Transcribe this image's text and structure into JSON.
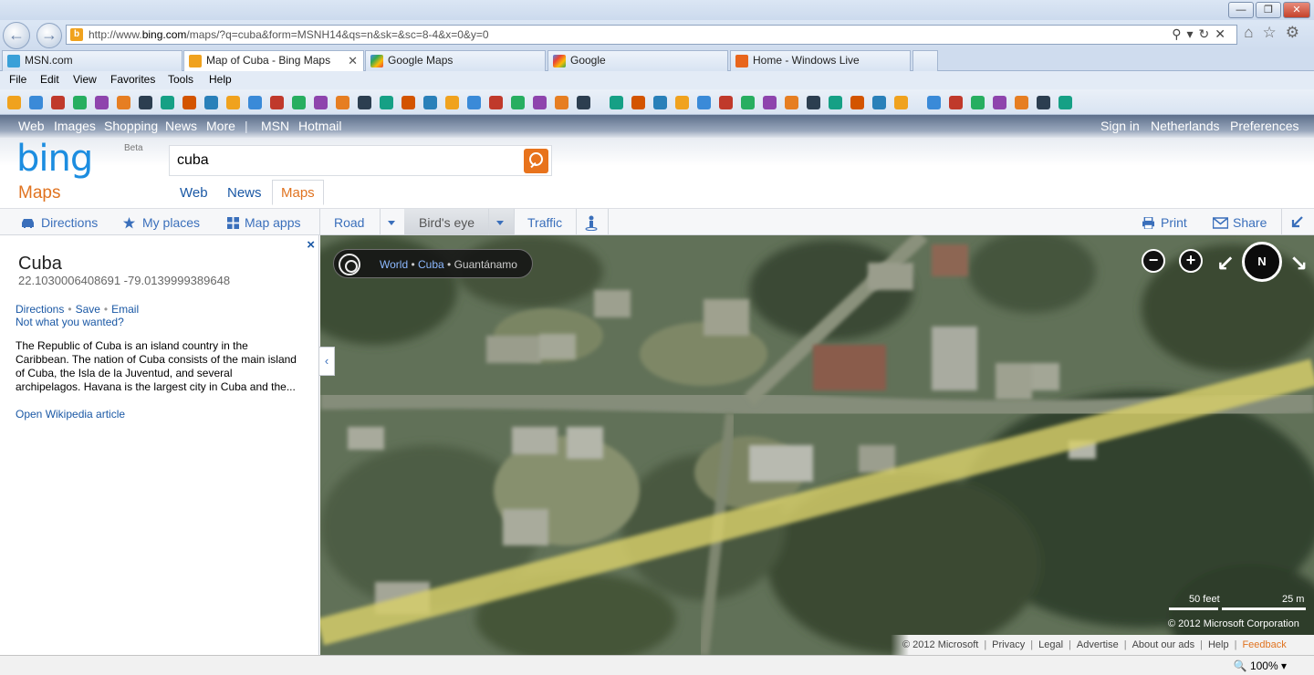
{
  "browser": {
    "url_prefix": "http://www.",
    "url_domain": "bing.com",
    "url_path": "/maps/?q=cuba&form=MSNH14&qs=n&sk=&sc=8-4&x=0&y=0",
    "tabs": [
      {
        "label": "MSN.com",
        "active": false
      },
      {
        "label": "Map of Cuba - Bing Maps",
        "active": true
      },
      {
        "label": "Google Maps",
        "active": false
      },
      {
        "label": "Google",
        "active": false
      },
      {
        "label": "Home - Windows Live",
        "active": false
      }
    ],
    "menu": [
      "File",
      "Edit",
      "View",
      "Favorites",
      "Tools",
      "Help"
    ],
    "zoom_level": "100%",
    "win_buttons": {
      "minimize": "—",
      "restore": "❐",
      "close": "✕"
    }
  },
  "bing": {
    "nav_left": [
      "Web",
      "Images",
      "Shopping",
      "News",
      "More",
      "|",
      "MSN",
      "Hotmail"
    ],
    "nav_right": [
      "Sign in",
      "Netherlands",
      "Preferences"
    ],
    "logo": "bing",
    "beta": "Beta",
    "section": "Maps",
    "search_value": "cuba",
    "vertical_tabs": [
      "Web",
      "News",
      "Maps"
    ]
  },
  "toolbar": {
    "directions": "Directions",
    "my_places": "My places",
    "map_apps": "Map apps",
    "road": "Road",
    "birds_eye": "Bird's eye",
    "traffic": "Traffic",
    "print": "Print",
    "share": "Share"
  },
  "result": {
    "title": "Cuba",
    "coords": "22.1030006408691 -79.0139999389648",
    "link_directions": "Directions",
    "link_save": "Save",
    "link_email": "Email",
    "not_what": "Not what you wanted?",
    "description": "The Republic of Cuba is an island country in the Caribbean. The nation of Cuba consists of the main island of Cuba, the Isla de la Juventud, and several archipelagos. Havana is the largest city in Cuba and the...",
    "wiki_link": "Open Wikipedia article",
    "close": "×"
  },
  "map": {
    "breadcrumb": {
      "world": "World",
      "cuba": "Cuba",
      "region": "Guantánamo",
      "sep": "•"
    },
    "scale_feet": "50 feet",
    "scale_m": "25 m",
    "copyright": "© 2012 Microsoft Corporation",
    "compass": "N",
    "zoom_out": "−",
    "zoom_in": "+",
    "collapse": "‹"
  },
  "footer": {
    "copyright": "© 2012 Microsoft",
    "links": [
      "Privacy",
      "Legal",
      "Advertise",
      "About our ads",
      "Help"
    ],
    "feedback": "Feedback"
  },
  "colors": {
    "bing_blue": "#1c8de0",
    "bing_orange": "#e07320",
    "link_blue": "#1a58a5",
    "road_yellow": "#d8cf6a"
  }
}
